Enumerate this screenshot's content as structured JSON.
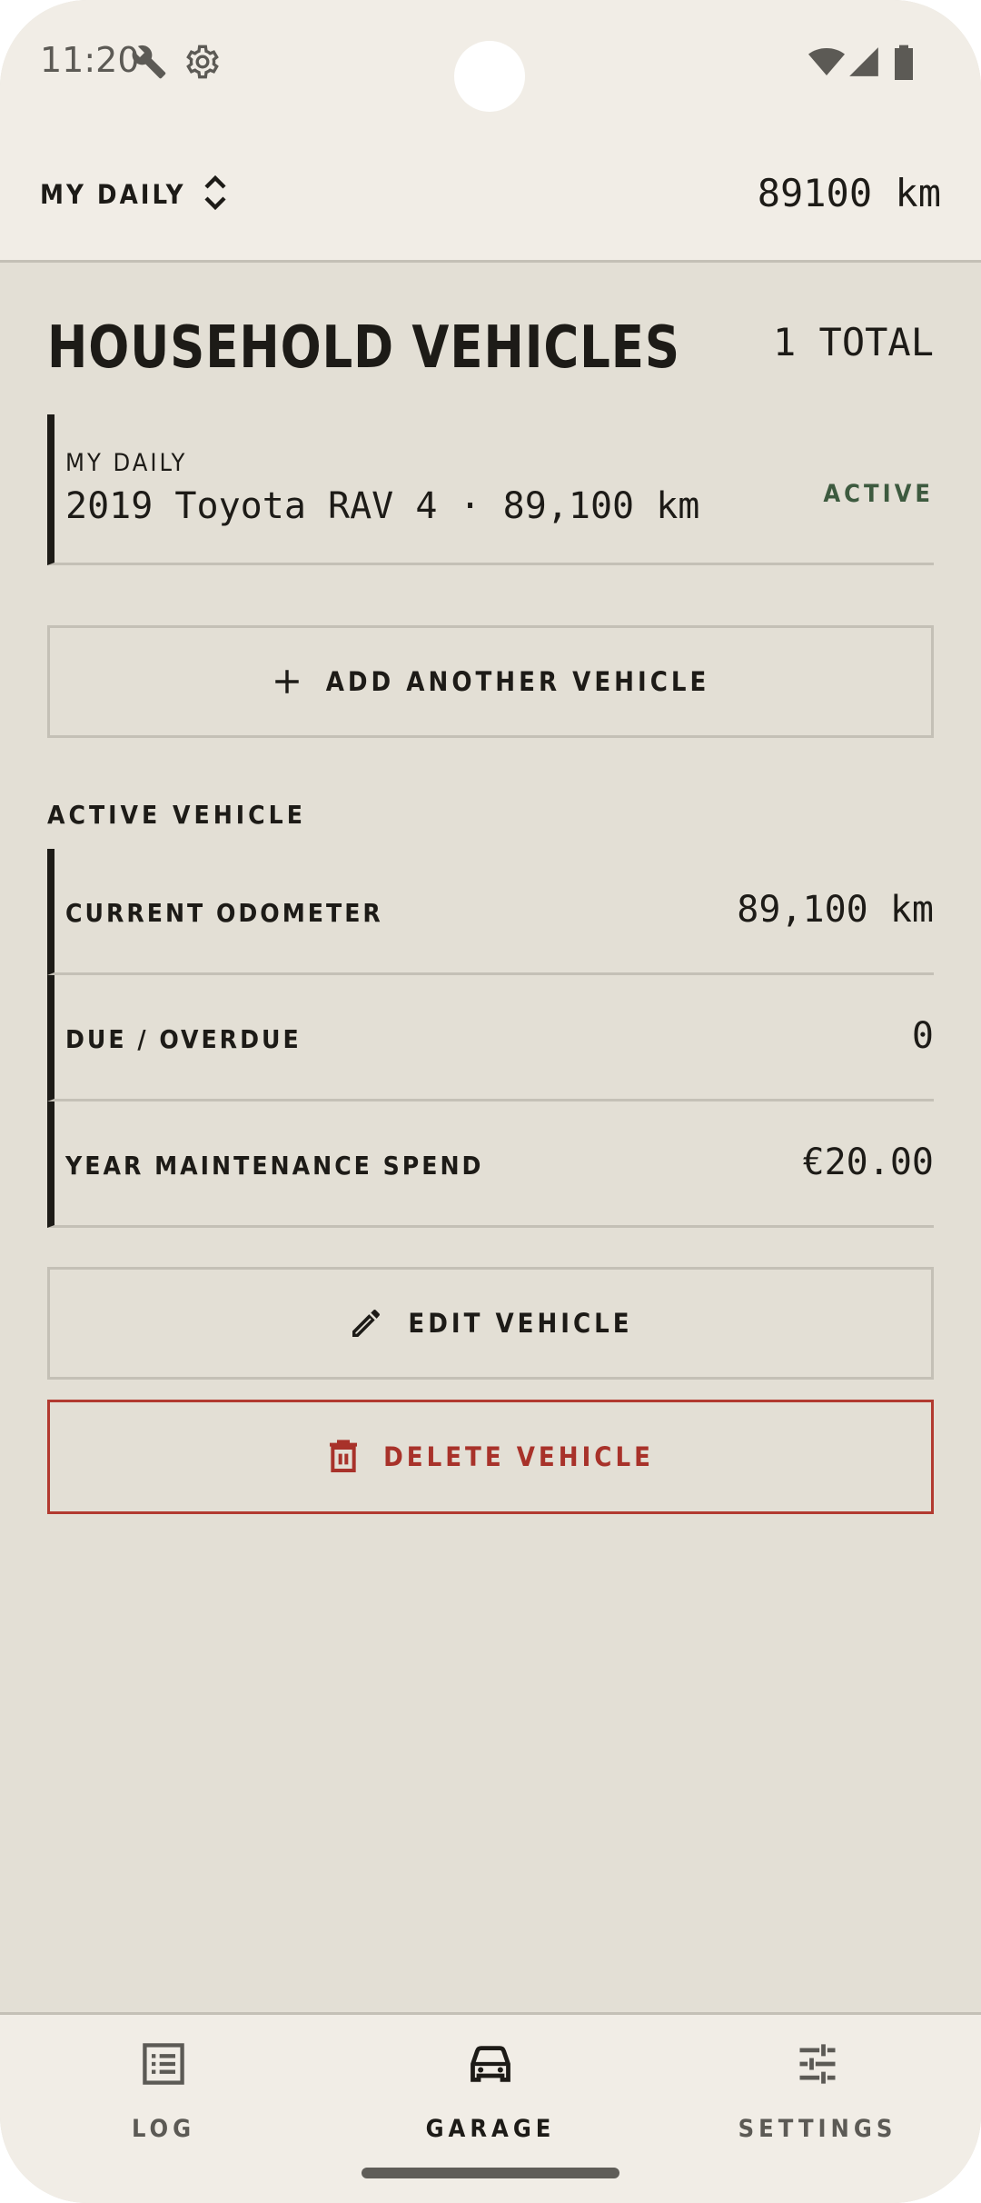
{
  "status_bar": {
    "time": "11:20",
    "icons": [
      "wrench-icon",
      "gear-icon",
      "wifi-icon",
      "signal-icon",
      "battery-icon"
    ]
  },
  "app_bar": {
    "vehicle_selector": "MY DAILY",
    "odometer": "89100 km"
  },
  "main": {
    "title": "HOUSEHOLD VEHICLES",
    "total": "1 TOTAL",
    "vehicles": [
      {
        "nickname": "MY DAILY",
        "description": "2019 Toyota RAV 4 · 89,100 km",
        "status": "ACTIVE"
      }
    ],
    "add_button": "ADD ANOTHER VEHICLE",
    "section_label": "ACTIVE VEHICLE",
    "stats": [
      {
        "label": "CURRENT ODOMETER",
        "value": "89,100 km"
      },
      {
        "label": "DUE / OVERDUE",
        "value": "0"
      },
      {
        "label": "YEAR MAINTENANCE SPEND",
        "value": "€20.00"
      }
    ],
    "edit_button": "EDIT VEHICLE",
    "delete_button": "DELETE VEHICLE"
  },
  "bottom_nav": {
    "items": [
      {
        "label": "LOG",
        "icon": "list-icon",
        "active": false
      },
      {
        "label": "GARAGE",
        "icon": "car-icon",
        "active": true
      },
      {
        "label": "SETTINGS",
        "icon": "sliders-icon",
        "active": false
      }
    ]
  },
  "colors": {
    "background": "#e3dfd5",
    "surface": "#f1ede6",
    "ink": "#1d1b17",
    "active_green": "#3d5a3f",
    "danger": "#a8322a",
    "divider": "#c4c0b6"
  }
}
